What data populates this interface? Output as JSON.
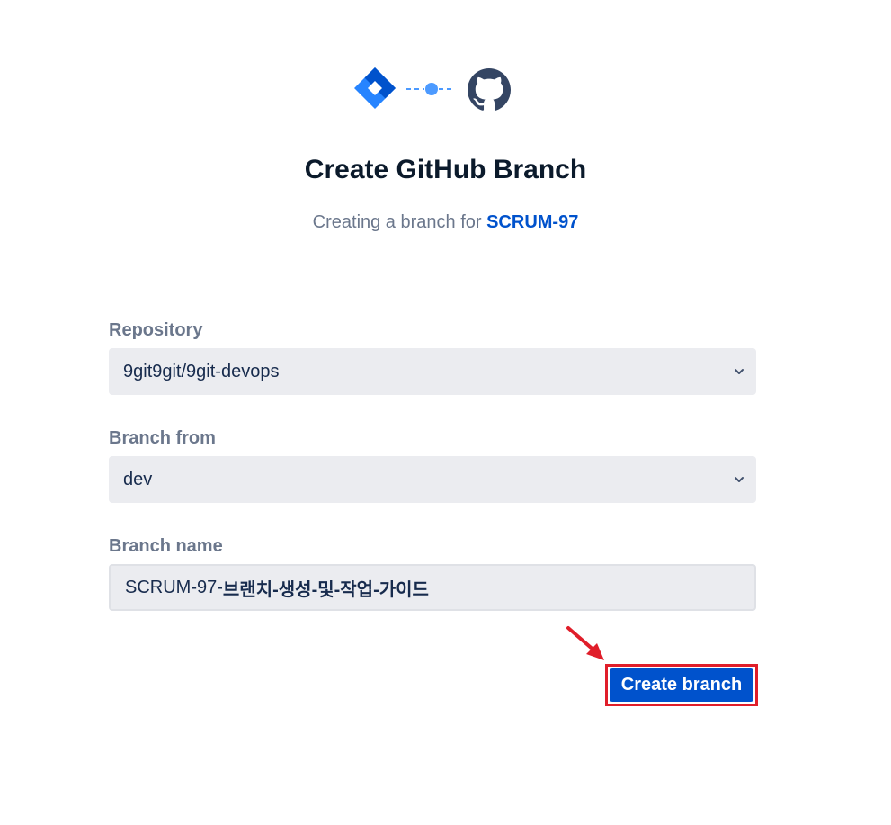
{
  "header": {
    "title": "Create GitHub Branch",
    "subtitle_prefix": "Creating a branch for ",
    "issue_key": "SCRUM-97"
  },
  "icons": {
    "left": "jira-logo-icon",
    "connector": "connection-dots-icon",
    "right": "github-logo-icon",
    "annotation": "red-arrow-icon"
  },
  "form": {
    "repository": {
      "label": "Repository",
      "value": "9git9git/9git-devops"
    },
    "branch_from": {
      "label": "Branch from",
      "value": "dev"
    },
    "branch_name": {
      "label": "Branch name",
      "value_prefix": "SCRUM-97-",
      "value_suffix": "브랜치-생성-및-작업-가이드"
    }
  },
  "actions": {
    "create_label": "Create branch"
  },
  "colors": {
    "accent": "#0052cc",
    "field_bg": "#ebecf0",
    "label": "#6b778c",
    "highlight": "#e01e2a"
  }
}
